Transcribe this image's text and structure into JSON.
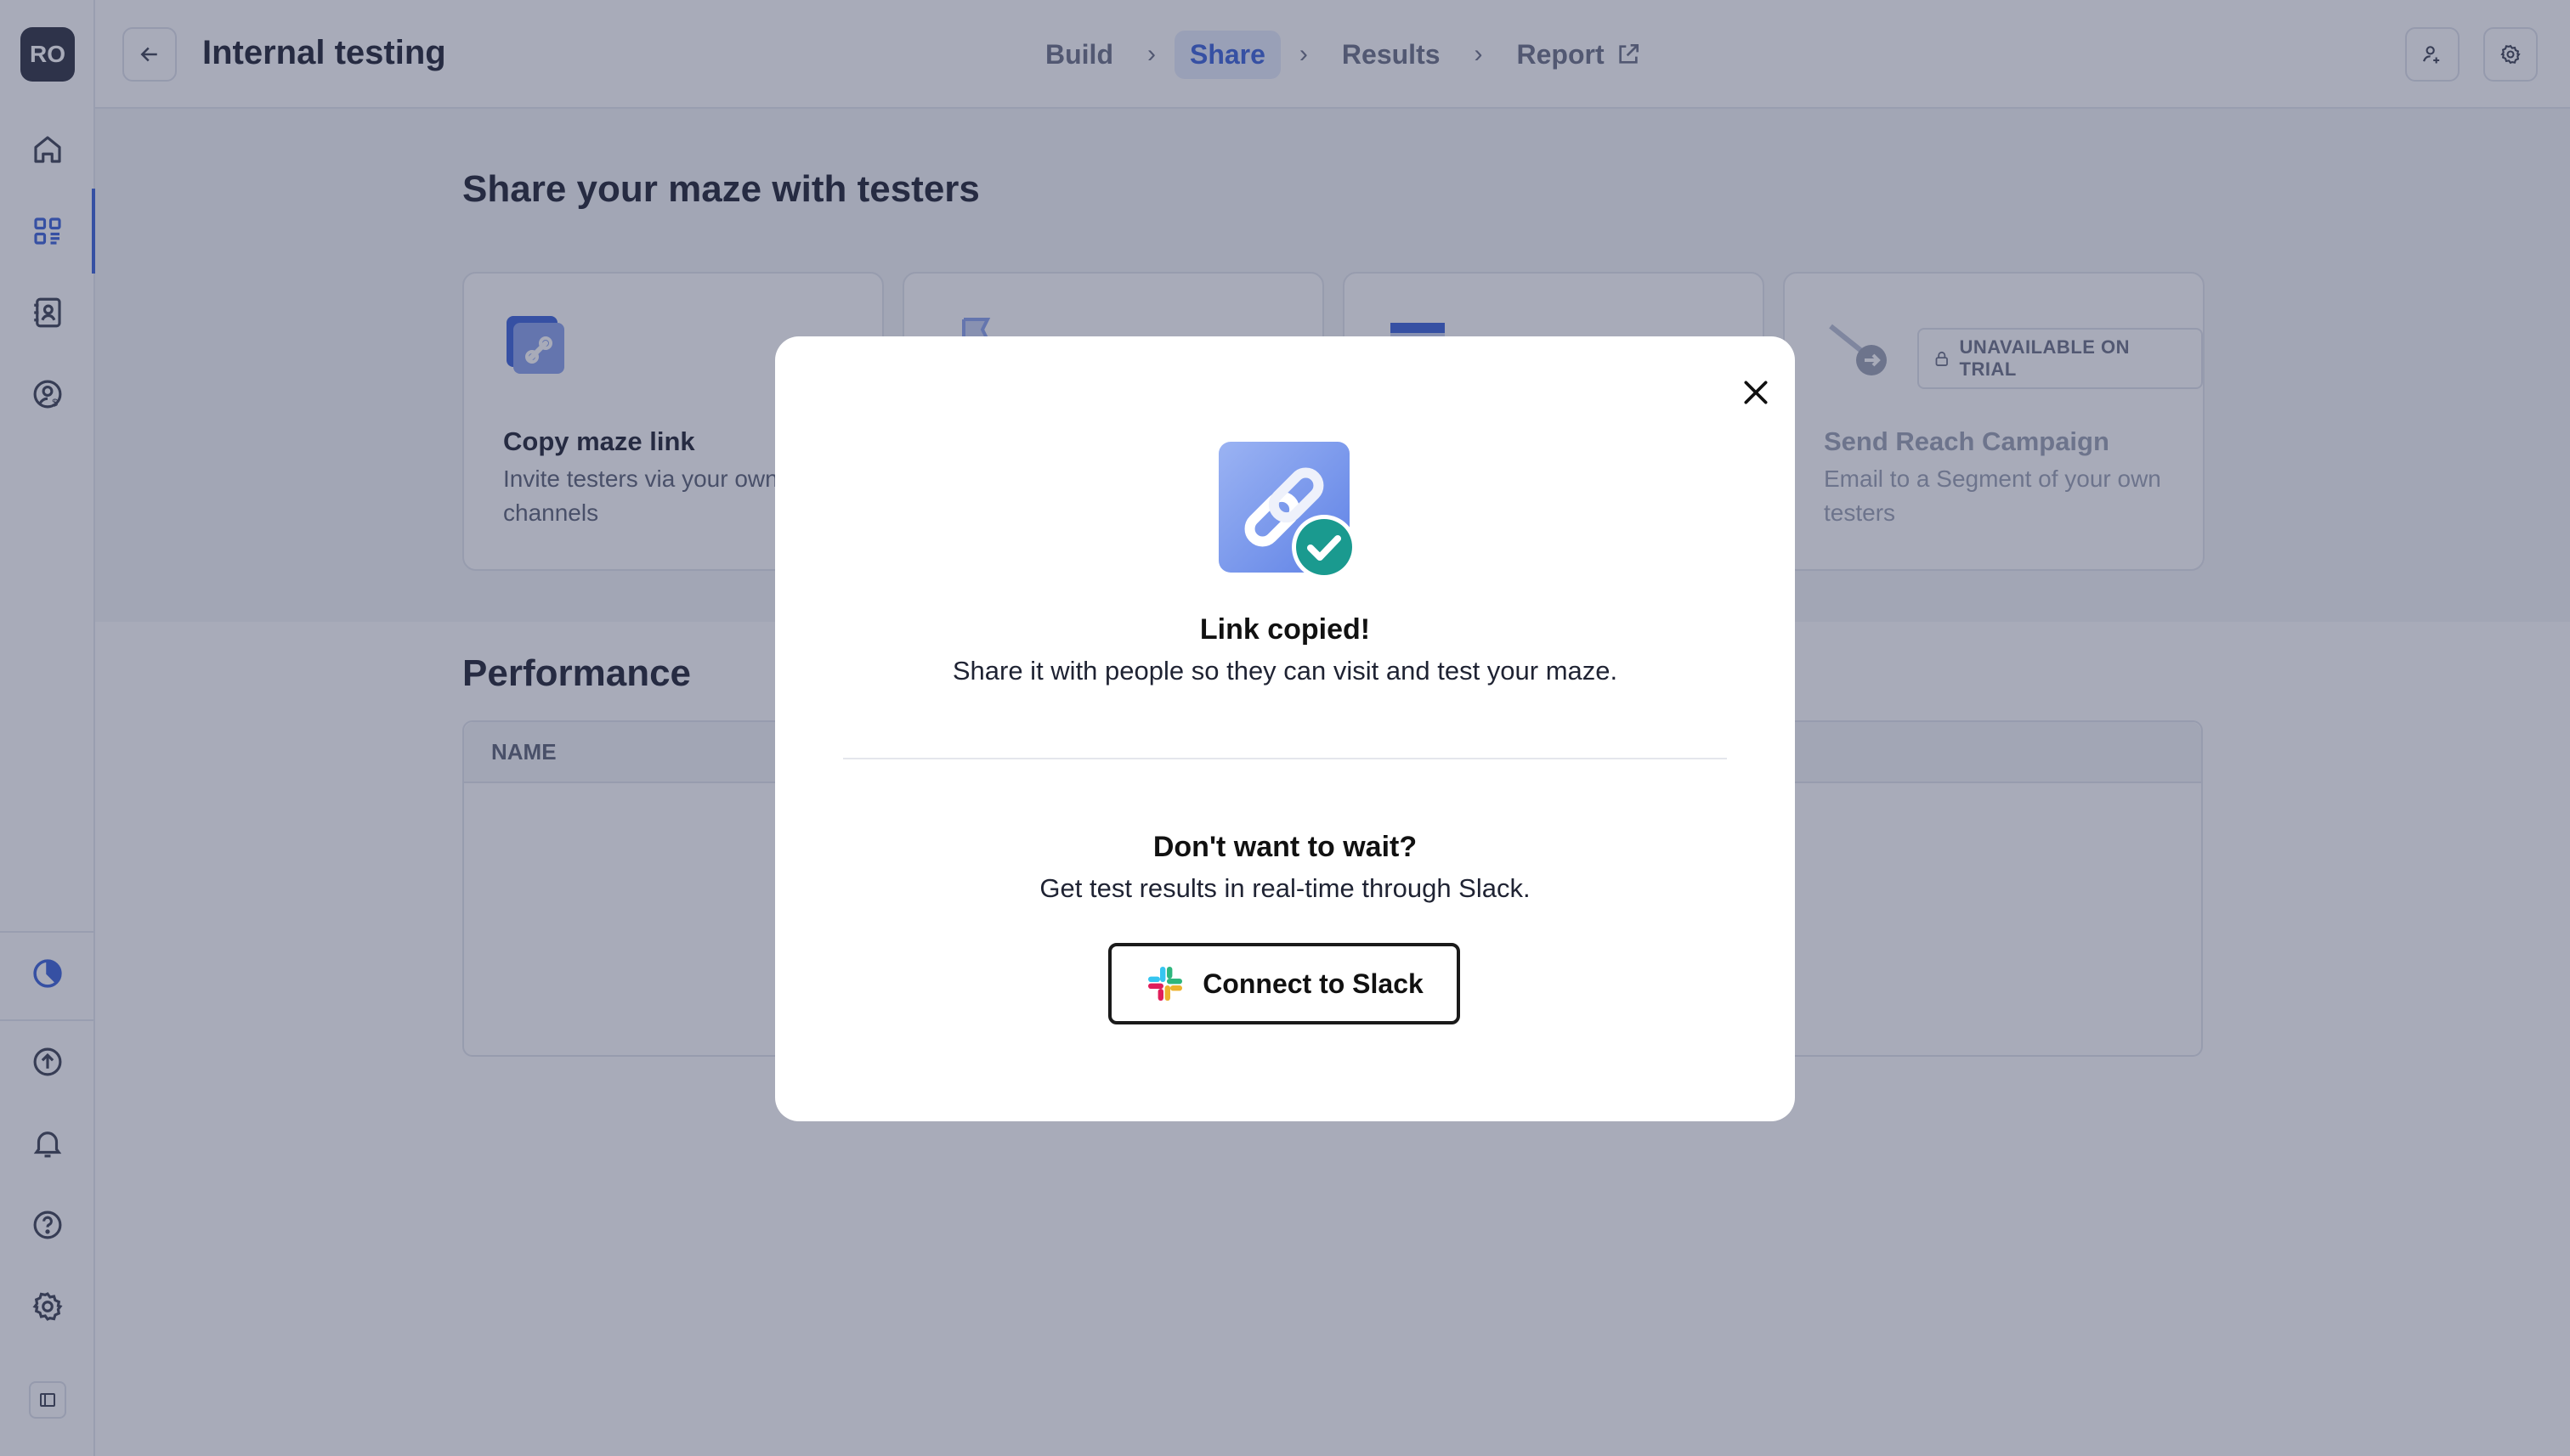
{
  "sidebar": {
    "workspace_initials": "RO",
    "icons": [
      "home-icon",
      "dashboard-icon",
      "contacts-icon",
      "user-settings-icon",
      "usage-icon",
      "upload-icon",
      "bell-icon",
      "help-icon",
      "gear-icon",
      "panel-toggle-icon"
    ]
  },
  "header": {
    "title": "Internal testing",
    "steps": [
      {
        "label": "Build",
        "active": false
      },
      {
        "label": "Share",
        "active": true
      },
      {
        "label": "Results",
        "active": false
      },
      {
        "label": "Report",
        "active": false
      }
    ]
  },
  "share": {
    "title": "Share your maze with testers",
    "cards": [
      {
        "title": "Copy maze link",
        "desc": "Invite testers via your own channels"
      },
      {
        "title": "",
        "desc": ""
      },
      {
        "title": "",
        "desc": ""
      },
      {
        "title": "Send Reach Campaign",
        "desc": "Email to a Segment of your own testers",
        "badge": "UNAVAILABLE ON TRIAL"
      }
    ]
  },
  "performance": {
    "title": "Performance",
    "column_name": "NAME"
  },
  "modal": {
    "title": "Link copied!",
    "subtitle": "Share it with people so they can visit and test your maze.",
    "title2": "Don't want to wait?",
    "subtitle2": "Get test results in real-time through Slack.",
    "slack_button": "Connect to Slack"
  },
  "colors": {
    "accent": "#3b63d9",
    "check_badge": "#1a9a8f",
    "overlay": "#303758"
  }
}
